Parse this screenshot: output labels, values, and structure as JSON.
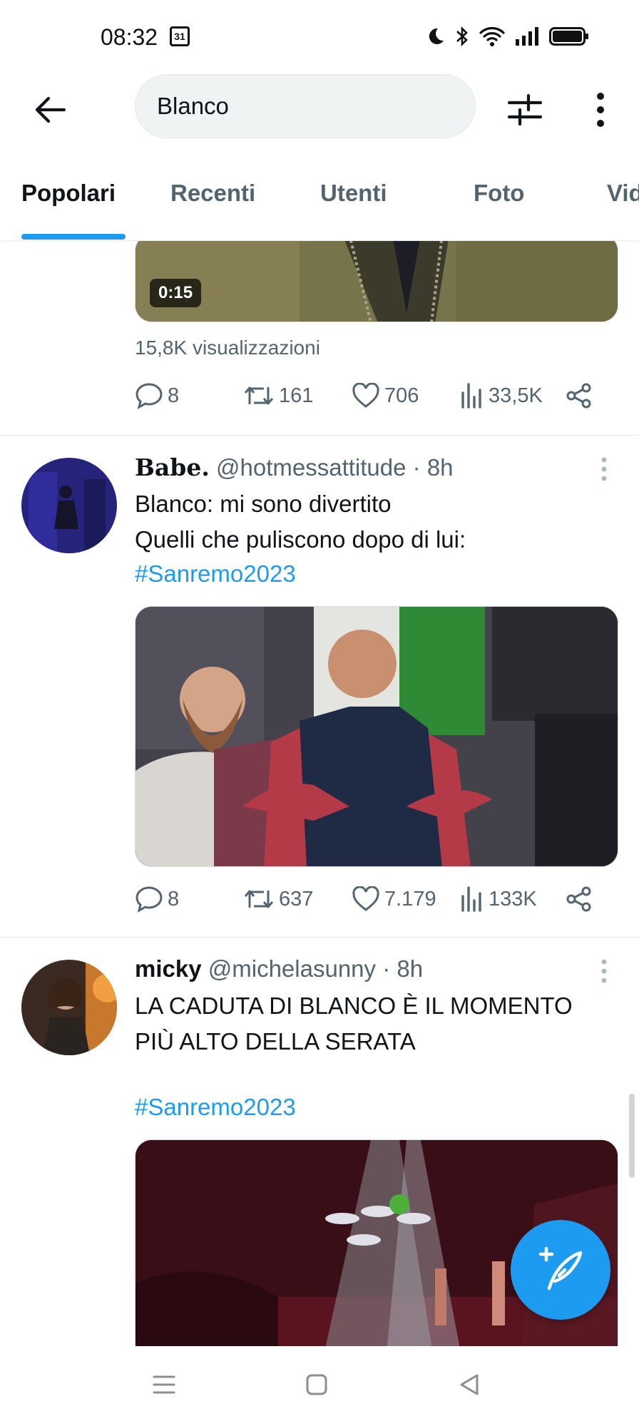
{
  "status_bar": {
    "time": "08:32",
    "calendar_day": "31",
    "icons": [
      "moon-icon",
      "bluetooth-icon",
      "wifi-icon",
      "signal-icon",
      "battery-icon"
    ]
  },
  "search": {
    "query": "Blanco",
    "icons": [
      "back-arrow-icon",
      "filter-sliders-icon",
      "more-vertical-icon"
    ]
  },
  "tabs": [
    {
      "label": "Popolari",
      "active": true
    },
    {
      "label": "Recenti",
      "active": false
    },
    {
      "label": "Utenti",
      "active": false
    },
    {
      "label": "Foto",
      "active": false
    },
    {
      "label": "Video",
      "active": false
    }
  ],
  "tweets": [
    {
      "media": {
        "type": "video",
        "duration": "0:15"
      },
      "views": "15,8K visualizzazioni",
      "stats": {
        "replies": "8",
        "retweets": "161",
        "likes": "706",
        "views": "33,5K"
      }
    },
    {
      "name": "Babe.",
      "handle": "@hotmessattitude",
      "time": "· 8h",
      "text": [
        "Blanco: mi sono divertito",
        "Quelli che puliscono dopo di lui:"
      ],
      "hashtag": "#Sanremo2023",
      "media": {
        "type": "photo"
      },
      "stats": {
        "replies": "8",
        "retweets": "637",
        "likes": "7.179",
        "views": "133K"
      }
    },
    {
      "name": "micky",
      "handle": "@michelasunny",
      "time": "· 8h",
      "text": [
        "LA CADUTA DI BLANCO È IL MOMENTO",
        "PIÙ ALTO DELLA SERATA"
      ],
      "hashtag": "#Sanremo2023",
      "media": {
        "type": "video"
      }
    }
  ],
  "fab": {
    "icon": "compose-tweet-icon"
  },
  "nav_bar": {
    "icons": [
      "menu-icon",
      "home-square-icon",
      "back-triangle-icon"
    ]
  },
  "colors": {
    "accent": "#1d9bf0",
    "text": "#0f1419",
    "muted": "#536471",
    "divider": "#e6ecf0"
  }
}
